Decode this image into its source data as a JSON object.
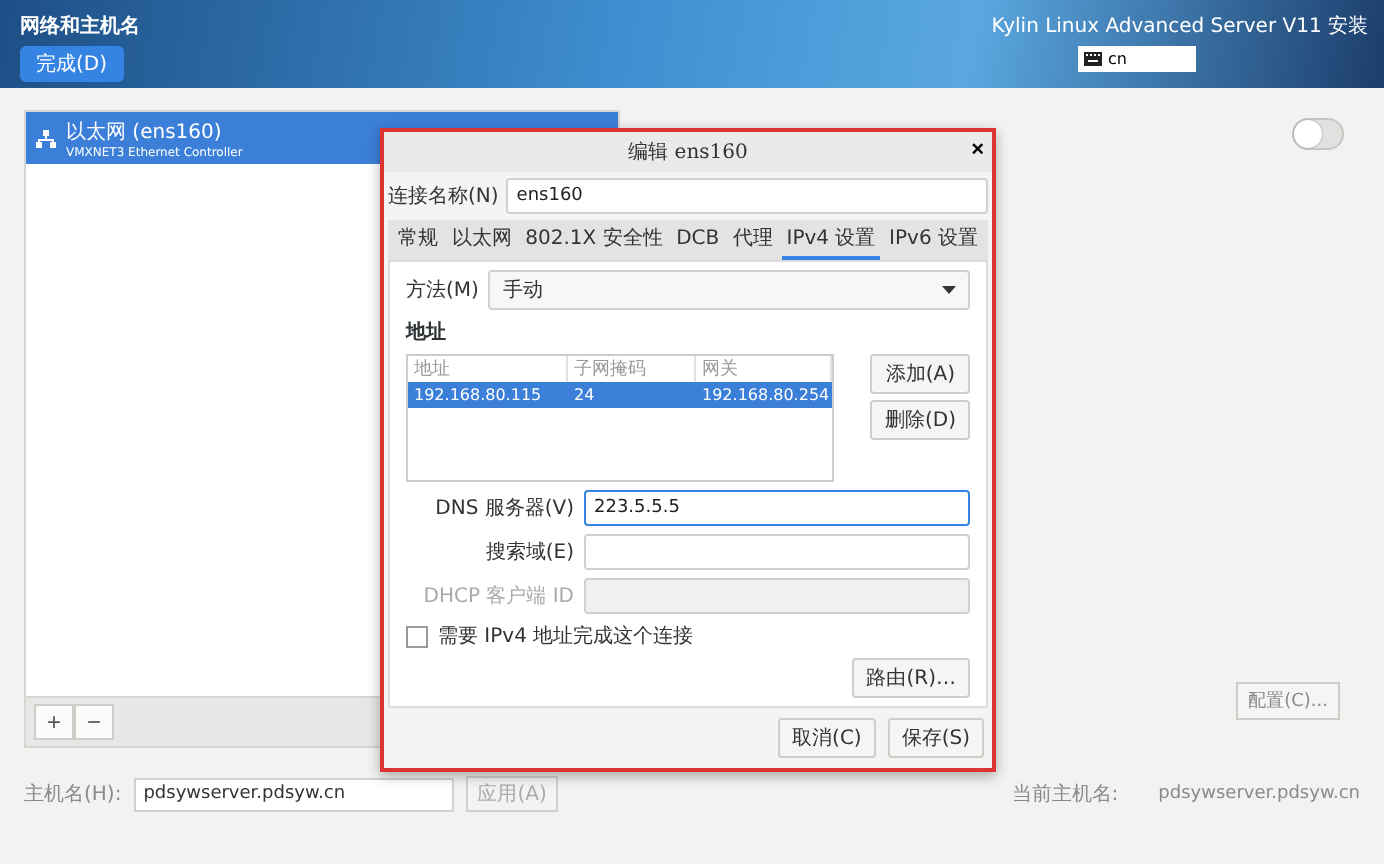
{
  "header": {
    "title": "网络和主机名",
    "done_button": "完成(D)",
    "product": "Kylin Linux Advanced Server V11 安装",
    "keyboard": "cn"
  },
  "connections": [
    {
      "name": "以太网 (ens160)",
      "description": "VMXNET3 Ethernet Controller",
      "selected": true
    }
  ],
  "list_toolbar": {
    "add": "+",
    "remove": "−"
  },
  "hostname": {
    "label": "主机名(H):",
    "value": "pdsywserver.pdsyw.cn",
    "apply_button": "应用(A)"
  },
  "device_switch": {
    "on": false
  },
  "configure_button": "配置(C)...",
  "current_hostname": {
    "label": "当前主机名:",
    "value": "pdsywserver.pdsyw.cn"
  },
  "dialog": {
    "title": "编辑 ens160",
    "close": "×",
    "connection_name": {
      "label": "连接名称(N)",
      "value": "ens160"
    },
    "tabs": [
      {
        "label": "常规",
        "selected": false
      },
      {
        "label": "以太网",
        "selected": false
      },
      {
        "label": "802.1X 安全性",
        "selected": false
      },
      {
        "label": "DCB",
        "selected": false
      },
      {
        "label": "代理",
        "selected": false
      },
      {
        "label": "IPv4 设置",
        "selected": true
      },
      {
        "label": "IPv6 设置",
        "selected": false
      }
    ],
    "method": {
      "label": "方法(M)",
      "value": "手动"
    },
    "address_section": "地址",
    "address_table": {
      "columns": [
        "地址",
        "子网掩码",
        "网关"
      ],
      "rows": [
        {
          "cells": [
            "192.168.80.115",
            "24",
            "192.168.80.254"
          ],
          "selected": true
        }
      ]
    },
    "add_button": "添加(A)",
    "delete_button": "删除(D)",
    "fields": [
      {
        "label": "DNS 服务器(V)",
        "value": "223.5.5.5",
        "focused": true,
        "disabled": false
      },
      {
        "label": "搜索域(E)",
        "focused": false,
        "disabled": false
      },
      {
        "label": "DHCP 客户端 ID",
        "focused": false,
        "disabled": true
      }
    ],
    "require_ipv4": {
      "label": "需要 IPv4 地址完成这个连接",
      "checked": false
    },
    "routes_button": "路由(R)…",
    "cancel_button": "取消(C)",
    "save_button": "保存(S)"
  }
}
